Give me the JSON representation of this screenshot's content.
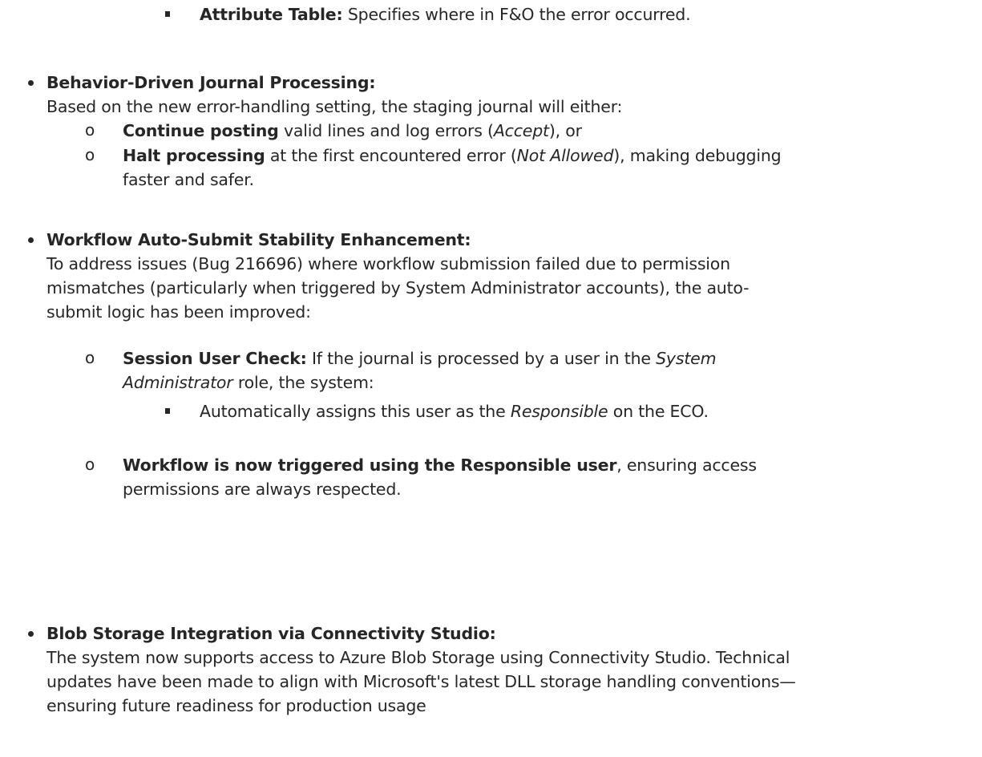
{
  "item_attribute_table": {
    "label": "Attribute Table:",
    "text": " Specifies where in F&O the error occurred."
  },
  "behavior": {
    "heading": "Behavior-Driven Journal Processing:",
    "intro": "Based on the new error-handling setting, the staging journal will either:",
    "sub1": {
      "bold": "Continue posting",
      "text_a": " valid lines and log errors (",
      "italic": "Accept",
      "text_b": "), or"
    },
    "sub2": {
      "bold": "Halt processing",
      "text_a": " at the first encountered error (",
      "italic": "Not Allowed",
      "text_b": "), making debugging",
      "cont": "faster and safer."
    }
  },
  "workflow": {
    "heading": "Workflow Auto-Submit Stability Enhancement:",
    "para_l1": "To address issues (Bug 216696) where workflow submission failed due to permission",
    "para_l2": "mismatches (particularly when triggered by System Administrator accounts), the auto-",
    "para_l3": "submit logic has been improved:",
    "sub1": {
      "bold": "Session User Check:",
      "text_a": " If the journal is processed by a user in the ",
      "italic_a": "System",
      "italic_b": "Administrator",
      "text_b": " role, the system:"
    },
    "sub1_item": {
      "text_a": "Automatically assigns this user as the ",
      "italic": "Responsible",
      "text_b": " on the ECO."
    },
    "sub2": {
      "bold": "Workflow is now triggered using the Responsible user",
      "text_a": ", ensuring access",
      "cont": "permissions are always respected."
    }
  },
  "blob": {
    "heading": "Blob Storage Integration via Connectivity Studio:",
    "para_l1": "The system now supports access to Azure Blob Storage using Connectivity Studio. Technical",
    "para_l2": "updates have been made to align with Microsoft's latest DLL storage handling conventions—",
    "para_l3": "ensuring future readiness for production usage"
  },
  "markers": {
    "hollow_circle": "o"
  }
}
